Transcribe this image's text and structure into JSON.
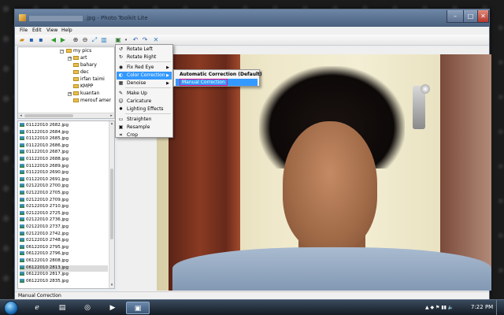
{
  "window": {
    "title_file": "0612201028",
    "title_suffix": ".jpg - Photo Toolkit Lite"
  },
  "menu": [
    "File",
    "Edit",
    "View",
    "Help"
  ],
  "tree": {
    "items": [
      {
        "label": "my pics",
        "expanded": true
      },
      {
        "label": "art"
      },
      {
        "label": "bahary"
      },
      {
        "label": "dec"
      },
      {
        "label": "irfan taimi"
      },
      {
        "label": "KMPP"
      },
      {
        "label": "kuantan"
      },
      {
        "label": "merouf amer"
      }
    ]
  },
  "files": [
    "01122010 2682.jpg",
    "01122010 2684.jpg",
    "01122010 2685.jpg",
    "01122010 2686.jpg",
    "01122010 2687.jpg",
    "01122010 2688.jpg",
    "01122010 2689.jpg",
    "01122010 2690.jpg",
    "01122010 2691.jpg",
    "02122010 2700.jpg",
    "02122010 2705.jpg",
    "02122010 2709.jpg",
    "02122010 2710.jpg",
    "02122010 2725.jpg",
    "02122010 2736.jpg",
    "02122010 2737.jpg",
    "02122010 2742.jpg",
    "02122010 2748.jpg",
    "06122010 2795.jpg",
    "06122010 2796.jpg",
    "06122010 2808.jpg",
    "06122010 2813.jpg",
    "06122010 2817.jpg",
    "06122010 2835.jpg"
  ],
  "selected_file_index": 21,
  "context_menu": {
    "items": [
      {
        "label": "Rotate Left",
        "icon": "rotate-left-icon",
        "glyph": "↺"
      },
      {
        "label": "Rotate Right",
        "icon": "rotate-right-icon",
        "glyph": "↻"
      },
      {
        "label": "Fix Red Eye",
        "icon": "red-eye-icon",
        "glyph": "◉",
        "submenu": true
      },
      {
        "label": "Color Correction",
        "icon": "color-correction-icon",
        "glyph": "◐",
        "submenu": true,
        "active": true
      },
      {
        "label": "Denoise",
        "icon": "denoise-icon",
        "glyph": "▦",
        "submenu": true
      },
      {
        "label": "Make Up",
        "icon": "make-up-icon",
        "glyph": "✎"
      },
      {
        "label": "Caricature",
        "icon": "caricature-icon",
        "glyph": "☺"
      },
      {
        "label": "Lighting Effects",
        "icon": "lighting-effects-icon",
        "glyph": "✸"
      },
      {
        "label": "Straighten",
        "icon": "straighten-icon",
        "glyph": "▭"
      },
      {
        "label": "Resample",
        "icon": "resample-icon",
        "glyph": "▣"
      },
      {
        "label": "Crop",
        "icon": "crop-icon",
        "glyph": "⌗"
      }
    ]
  },
  "submenu": {
    "items": [
      {
        "label": "Automatic Correction (Default)"
      },
      {
        "label": "Manual Correction"
      }
    ]
  },
  "status": {
    "text": "Manual Correction"
  },
  "taskbar": {
    "time": "7:22 PM",
    "tray_label": "▲ ◆ ⚑ ▮▮ 🔈"
  },
  "colors": {
    "highlight": "#3399ff",
    "focus_border": "#e0138c"
  }
}
